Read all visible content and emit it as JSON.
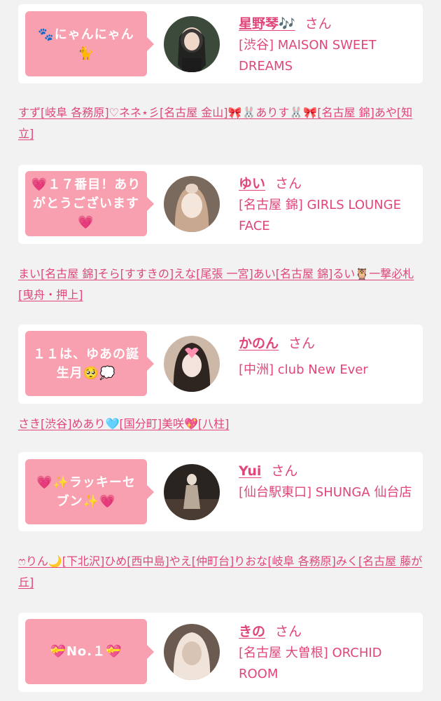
{
  "entries": [
    {
      "bubble": "🐾にゃんにゃん🐈",
      "name": "星野琴🎶",
      "san": "さん",
      "shop": "[渋谷] MAISON SWEET DREAMS",
      "avatar_colors": [
        "#3b4a3a",
        "#1c1c1c",
        "#f0d8c8"
      ]
    },
    {
      "bubble": "💗１７番目！ありがとうございます💗",
      "name": "ゆい",
      "san": "さん",
      "shop": "[名古屋 錦] GIRLS LOUNGE FACE",
      "avatar_colors": [
        "#7a6a5e",
        "#e9d4c8",
        "#f5e6dc"
      ]
    },
    {
      "bubble": "１１は、ゆあの誕生月🥺💭",
      "name": "かのん",
      "san": "さん",
      "shop": "[中洲] club New Ever",
      "avatar_colors": [
        "#cdb8a8",
        "#2e2420",
        "#f3e3dc"
      ]
    },
    {
      "bubble": "💗✨ラッキーセブン✨💗",
      "name": "Yui",
      "san": "さん",
      "shop": "[仙台駅東口] SHUNGA 仙台店",
      "avatar_colors": [
        "#2a2420",
        "#b8a898",
        "#e8dcd0"
      ]
    },
    {
      "bubble": "💝No.１💝",
      "name": "きの",
      "san": "さん",
      "shop": "[名古屋 大曽根] ORCHID ROOM",
      "avatar_colors": [
        "#6a5a50",
        "#f0e4da",
        "#d8c4b4"
      ]
    }
  ],
  "link_rows": [
    [
      "すず",
      "[岐阜 各務原]",
      "♡ネネ⋆彡",
      "[名古屋 金山]",
      "🎀🐰ありす🐰🎀",
      "[名古屋 錦]",
      "あや",
      "[知立]"
    ],
    [
      "まい",
      "[名古屋 錦]",
      "そら",
      "[すすきの]",
      "えな",
      "[尾張 一宮]",
      "あい",
      "[名古屋 錦]",
      "るい🦉一撃必札",
      "[曳舟・押上]"
    ],
    [
      "さき",
      "[渋谷]",
      "めあり🩵",
      "[国分町]",
      "美咲💖",
      "[八柱]"
    ],
    [
      "ෆりん🌙",
      "[下北沢]",
      "ひめ",
      "[西中島]",
      "やえ",
      "[仲町台]",
      "りおな",
      "[岐阜 各務原]",
      "みく",
      "[名古屋 藤が丘]"
    ]
  ],
  "colors": {
    "accent": "#e0457b",
    "bubble": "#f8a0b0",
    "background": "#f2f2f2",
    "card": "#ffffff"
  }
}
